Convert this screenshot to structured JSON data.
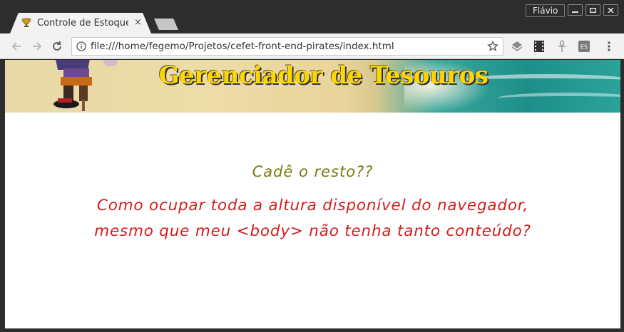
{
  "browser": {
    "tab_title": "Controle de Estoque",
    "tab_close": "×",
    "user_name": "Flávio",
    "url": "file:///home/fegemo/Projetos/cefet-front-end-pirates/index.html"
  },
  "page": {
    "banner_title": "Gerenciador de Tesouros",
    "question": "Cadê o resto??",
    "description_line1": "Como ocupar toda a altura disponível do navegador,",
    "description_line2": "mesmo que meu <body> não tenha tanto conteúdo?"
  },
  "colors": {
    "banner_title": "#ffd700",
    "question": "#7a7a10",
    "description": "#d31d1d"
  }
}
